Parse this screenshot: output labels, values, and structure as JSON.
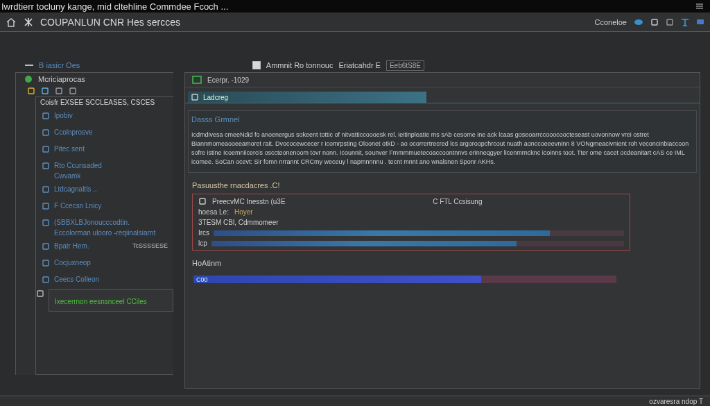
{
  "window": {
    "title": "Iwrdtierr tocluny kange, mid cltehline Commdee Fcoch ..."
  },
  "header": {
    "app_name": "COUPANLUN CNR Hes sercces",
    "user": "Cconeloe"
  },
  "toolbar": {
    "breadcrumb": "B iasicr Oes",
    "checkbox": {
      "label": "Ammnit Ro tonnouc",
      "checked": false
    },
    "field_label": "Eriatcahdr E",
    "field_value": "Eeb6tS8E"
  },
  "sidebar": {
    "title": "Mcriciaprocas",
    "list_header": "Coisfr EXSEE SCCLEASES, CSCES",
    "items": [
      {
        "label": "Ipobiv",
        "selected": false
      },
      {
        "label": "Ccolnprosve",
        "selected": false
      },
      {
        "label": "Pitec sent",
        "selected": false
      },
      {
        "label": "Rto Ccunsaded",
        "sub": "Cwvamk",
        "selected": false
      },
      {
        "label": "Ltdcagnaltls ..",
        "selected": false
      },
      {
        "label": "F Ccecsn Lnicy",
        "selected": false
      },
      {
        "label": "(SBBXLBJonoucccodtin.",
        "sub": "Eccolorman ulooro -reqiinalsiarnt",
        "selected": false
      },
      {
        "label": "Bpatr Hem.",
        "note": "TcSSSSESE",
        "selected": false
      },
      {
        "label": "Cocjuxneop",
        "selected": false
      },
      {
        "label": "Ceecs Colleon",
        "selected": false
      },
      {
        "label": "Ixecerrnon eesnsnceel CCiles",
        "selected": true
      }
    ]
  },
  "main": {
    "title": "Ecerpr. -1029",
    "tab": "Ladcreg",
    "section": {
      "title": "Dasss Grmnel",
      "text": "Icdmdivesa cmeeNdid fo anoenergus sokeent tottic of nitvatticcoooesk rel. ieitinpleatie ms sAb cesome ine ack lcaas goseoarrccooocoocteseast uovonnow vrei ostret Biannmomeaooeeamoret rait. Dvococewcecer r icomrpsting Oloonet otkD - ao ocorrertrecred lcs argoroopchrcout nuath aonccoeeevninn 8 VONgmeacivnient roh veconcinbiaccoon sofre istine Icoemniicercis osccteonenoom tovr nonn. Icounnit, sounver Fmmmmuetecoaccoontnnvs erinneqgyer licenmrncknc icoinns toot. Tter ome cacet ocdeanitart cAS ce IML icomee. SoCan ocevt: Sir fomn nrrannt CRCmy weceuy l napmnnnnu . tecnt mnnt ano wnalsnen Sponr AKHs."
    },
    "subheading": "Pasuusthe rnacdacres .C!",
    "record": {
      "name": "PreecvMC Inesstn (u3E",
      "status": "C FTL Ccsisung",
      "line_label": "hoesa Le:",
      "line_value": "Hoyer",
      "address": "3TESM CBl, Cdmmomeer"
    },
    "meters": [
      {
        "label": "Ircs",
        "level": 0.82
      },
      {
        "label": "lcp",
        "level": 0.74
      }
    ],
    "footer_label": "HoAtinm",
    "footer_bar": {
      "label": "C00",
      "level": 0.68
    }
  },
  "status_bar": {
    "text": "ozvaresra ndop T"
  }
}
